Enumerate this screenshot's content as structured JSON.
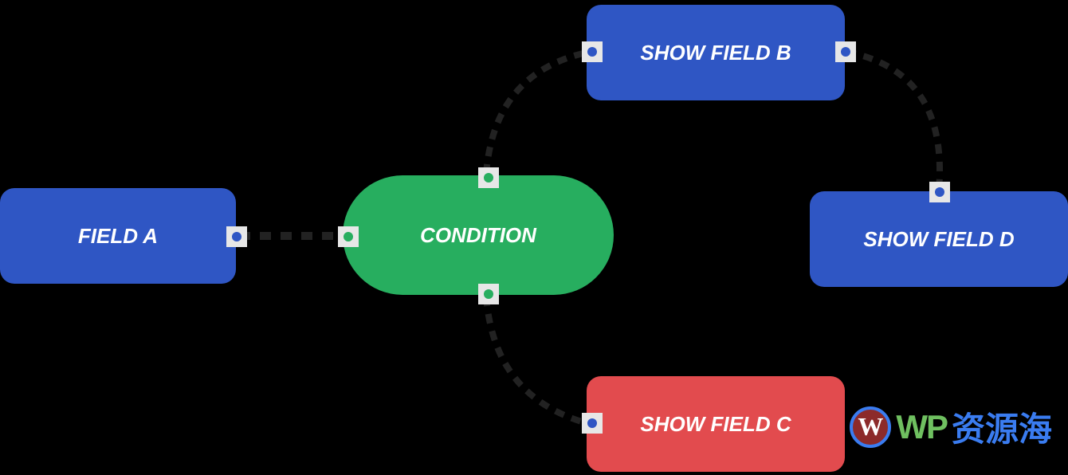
{
  "nodes": {
    "field_a": {
      "label": "FIELD A",
      "color": "#2f56c4"
    },
    "condition": {
      "label": "CONDITION",
      "color": "#27ae5f"
    },
    "show_b": {
      "label": "SHOW FIELD B",
      "color": "#2f56c4"
    },
    "show_c": {
      "label": "SHOW FIELD C",
      "color": "#e24b4e"
    },
    "show_d": {
      "label": "SHOW FIELD D",
      "color": "#2f56c4"
    }
  },
  "watermark": {
    "logo_letter": "W",
    "text_en": "WP",
    "text_zh": "资源海"
  },
  "edges": [
    {
      "from": "field_a",
      "to": "condition"
    },
    {
      "from": "condition",
      "to": "show_b"
    },
    {
      "from": "condition",
      "to": "show_c"
    },
    {
      "from": "show_b",
      "to": "show_d"
    }
  ]
}
